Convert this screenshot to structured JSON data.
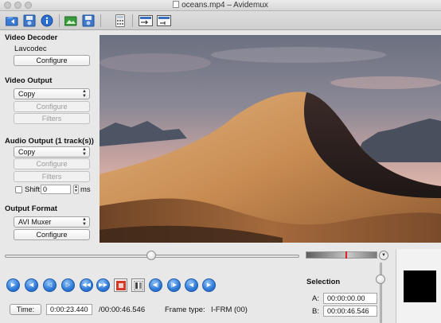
{
  "window": {
    "title": "oceans.mp4 – Avidemux"
  },
  "toolbar": {
    "icons": [
      "open-video-icon",
      "save-video-icon",
      "info-icon",
      "open-image-icon",
      "save-image-icon",
      "calculator-icon",
      "video-filter-icon",
      "audio-filter-icon"
    ]
  },
  "left_panel": {
    "video_decoder": {
      "title": "Video Decoder",
      "decoder": "Lavcodec",
      "configure": "Configure"
    },
    "video_output": {
      "title": "Video Output",
      "selected": "Copy",
      "configure": "Configure",
      "filters": "Filters"
    },
    "audio_output": {
      "title": "Audio Output (1 track(s))",
      "selected": "Copy",
      "configure": "Configure",
      "filters": "Filters",
      "shift_label": "Shift:",
      "shift_value": "0",
      "shift_unit": "ms"
    },
    "output_format": {
      "title": "Output Format",
      "selected": "AVI Muxer",
      "configure": "Configure"
    }
  },
  "playback": {
    "seek_position": 0.5,
    "nav_icons": [
      "play-icon",
      "previous-frame-icon",
      "back-icon",
      "forward-icon",
      "rewind-icon",
      "fast-forward-icon",
      "mark-a-icon",
      "mark-b-icon",
      "previous-keyframe-icon",
      "next-keyframe-icon",
      "previous-black-icon",
      "next-black-icon"
    ]
  },
  "status": {
    "time_button": "Time:",
    "current_time": "0:00:23.440",
    "total_time": "/00:00:46.546",
    "frame_type_label": "Frame type:",
    "frame_type_value": "I-FRM (00)"
  },
  "selection": {
    "title": "Selection",
    "a_label": "A:",
    "a_value": "00:00:00.00",
    "b_label": "B:",
    "b_value": "00:00:46.546"
  },
  "colors": {
    "accent_blue": "#2f7ad8",
    "sky_top": "#6f7484",
    "sand": "#c98f55"
  }
}
